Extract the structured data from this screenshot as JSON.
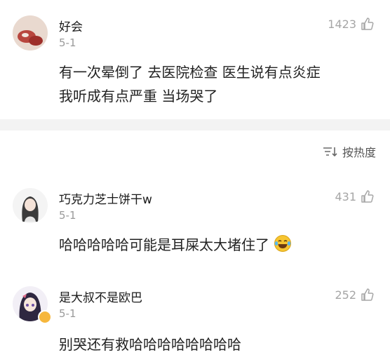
{
  "comments": [
    {
      "username": "好会",
      "date": "5-1",
      "likes": "1423",
      "lines": [
        "有一次晕倒了 去医院检查 医生说有点炎症",
        "我听成有点严重 当场哭了"
      ]
    },
    {
      "username": "巧克力芝士饼干w",
      "date": "5-1",
      "likes": "431",
      "text": "哈哈哈哈哈可能是耳屎太大堵住了"
    },
    {
      "username": "是大叔不是欧巴",
      "date": "5-1",
      "likes": "252",
      "text": "别哭还有救哈哈哈哈哈哈哈哈"
    }
  ],
  "sort": {
    "label": "按热度"
  },
  "icons": {
    "like": "thumbs-up-icon",
    "sort": "sort-icon",
    "emoji": "laughing-tears-emoji",
    "verified": "verified-badge-icon"
  },
  "colors": {
    "muted": "#9a9a9a",
    "divider": "#f3f3f3",
    "badge": "#f6b73c"
  }
}
